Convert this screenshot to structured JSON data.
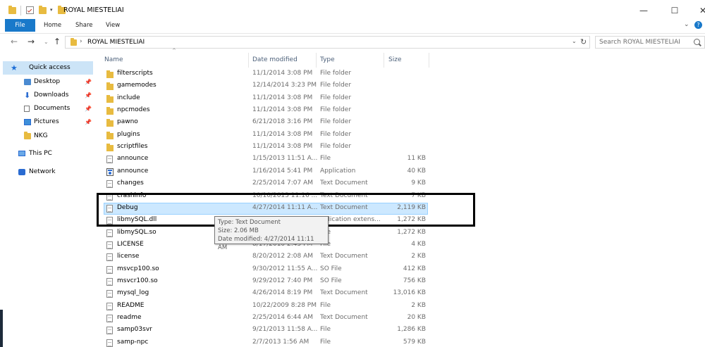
{
  "window": {
    "title": "ROYAL MIESTELIAI",
    "controls": {
      "minimize": "—",
      "maximize": "☐",
      "close": "✕"
    }
  },
  "ribbon": {
    "tabs": [
      "File",
      "Home",
      "Share",
      "View"
    ],
    "expand_icon": "chevron-down-icon",
    "help_icon": "?"
  },
  "address": {
    "separator": "›",
    "path": "ROYAL MIESTELIAI",
    "search_placeholder": "Search ROYAL MIESTELIAI"
  },
  "nav_pane": {
    "items": [
      {
        "label": "Quick access",
        "icon": "star-icon",
        "pinned": false
      },
      {
        "label": "Desktop",
        "icon": "desktop-icon",
        "pinned": true
      },
      {
        "label": "Downloads",
        "icon": "downloads-icon",
        "pinned": true
      },
      {
        "label": "Documents",
        "icon": "documents-icon",
        "pinned": true
      },
      {
        "label": "Pictures",
        "icon": "pictures-icon",
        "pinned": true
      },
      {
        "label": "NKG",
        "icon": "folder-icon",
        "pinned": false
      },
      {
        "label": "This PC",
        "icon": "pc-icon",
        "pinned": false
      },
      {
        "label": "Network",
        "icon": "network-icon",
        "pinned": false
      }
    ]
  },
  "columns": {
    "name": "Name",
    "date": "Date modified",
    "type": "Type",
    "size": "Size"
  },
  "files": [
    {
      "name": "filterscripts",
      "date": "11/1/2014 3:08 PM",
      "type": "File folder",
      "size": "",
      "kind": "folder"
    },
    {
      "name": "gamemodes",
      "date": "12/14/2014 3:23 PM",
      "type": "File folder",
      "size": "",
      "kind": "folder"
    },
    {
      "name": "include",
      "date": "11/1/2014 3:08 PM",
      "type": "File folder",
      "size": "",
      "kind": "folder"
    },
    {
      "name": "npcmodes",
      "date": "11/1/2014 3:08 PM",
      "type": "File folder",
      "size": "",
      "kind": "folder"
    },
    {
      "name": "pawno",
      "date": "6/21/2018 3:16 PM",
      "type": "File folder",
      "size": "",
      "kind": "folder"
    },
    {
      "name": "plugins",
      "date": "11/1/2014 3:08 PM",
      "type": "File folder",
      "size": "",
      "kind": "folder"
    },
    {
      "name": "scriptfiles",
      "date": "11/1/2014 3:08 PM",
      "type": "File folder",
      "size": "",
      "kind": "folder"
    },
    {
      "name": "announce",
      "date": "1/15/2013 11:51 A...",
      "type": "File",
      "size": "11 KB",
      "kind": "doc"
    },
    {
      "name": "announce",
      "date": "1/16/2014 5:41 PM",
      "type": "Application",
      "size": "40 KB",
      "kind": "app"
    },
    {
      "name": "changes",
      "date": "2/25/2014 7:07 AM",
      "type": "Text Document",
      "size": "9 KB",
      "kind": "doc"
    },
    {
      "name": "crashinfo",
      "date": "10/10/2013 11:16 ...",
      "type": "Text Document",
      "size": "7 KB",
      "kind": "doc"
    },
    {
      "name": "Debug",
      "date": "4/27/2014 11:11 A...",
      "type": "Text Document",
      "size": "2,119 KB",
      "kind": "doc",
      "selected": true
    },
    {
      "name": "libmySQL.dll",
      "date": "",
      "type": "pplication extens...",
      "size": "1,272 KB",
      "kind": "doc"
    },
    {
      "name": "libmySQL.so",
      "date": "",
      "type": "File",
      "size": "1,272 KB",
      "kind": "doc"
    },
    {
      "name": "LICENSE",
      "date": "8/17/2010 2:45 PM",
      "type": "File",
      "size": "4 KB",
      "kind": "doc"
    },
    {
      "name": "license",
      "date": "8/20/2012 2:08 AM",
      "type": "Text Document",
      "size": "2 KB",
      "kind": "doc"
    },
    {
      "name": "msvcp100.so",
      "date": "9/30/2012 11:55 A...",
      "type": "SO File",
      "size": "412 KB",
      "kind": "doc"
    },
    {
      "name": "msvcr100.so",
      "date": "9/29/2012 7:40 PM",
      "type": "SO File",
      "size": "756 KB",
      "kind": "doc"
    },
    {
      "name": "mysql_log",
      "date": "4/26/2014 8:19 PM",
      "type": "Text Document",
      "size": "13,016 KB",
      "kind": "doc"
    },
    {
      "name": "README",
      "date": "10/22/2009 8:28 PM",
      "type": "File",
      "size": "2 KB",
      "kind": "doc"
    },
    {
      "name": "readme",
      "date": "2/25/2014 6:44 AM",
      "type": "Text Document",
      "size": "20 KB",
      "kind": "doc"
    },
    {
      "name": "samp03svr",
      "date": "9/21/2013 11:58 A...",
      "type": "File",
      "size": "1,286 KB",
      "kind": "doc"
    },
    {
      "name": "samp-npc",
      "date": "2/7/2013 1:56 AM",
      "type": "File",
      "size": "579 KB",
      "kind": "doc"
    }
  ],
  "tooltip": {
    "type_line": "Type: Text Document",
    "size_line": "Size: 2.06 MB",
    "date_line": "Date modified: 4/27/2014 11:11 AM"
  }
}
